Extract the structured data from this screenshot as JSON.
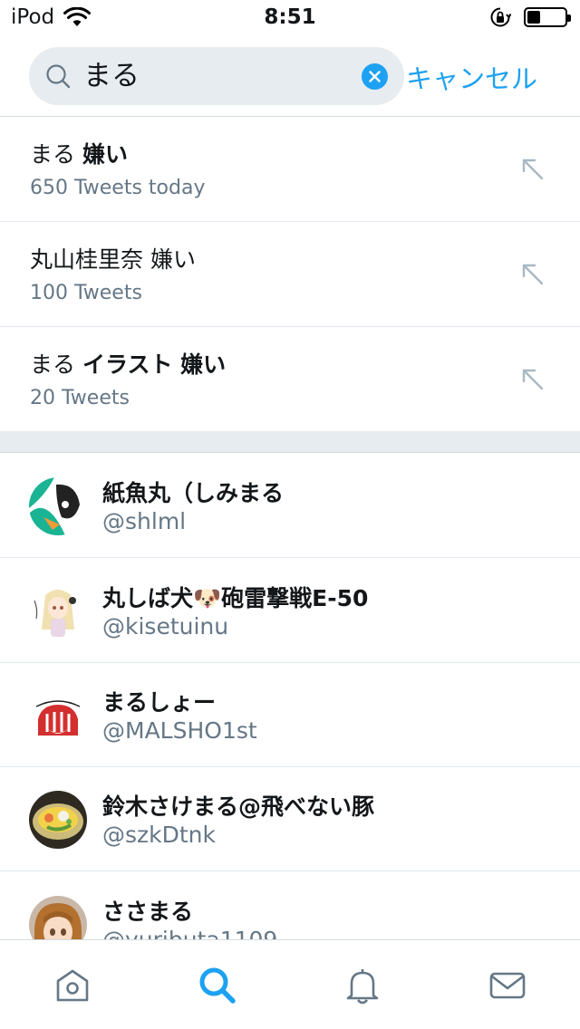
{
  "status_bar": {
    "carrier": "iPod",
    "time": "8:51"
  },
  "search": {
    "query": "まる",
    "cancel_label": "キャンセル"
  },
  "suggestions": [
    {
      "prefix": "まる",
      "bold": "嫌い",
      "count": "650 Tweets today"
    },
    {
      "prefix": "丸山桂里奈 嫌い",
      "bold": "",
      "count": "100 Tweets"
    },
    {
      "prefix": "まる",
      "bold": "イラスト 嫌い",
      "count": "20 Tweets"
    }
  ],
  "users": [
    {
      "name": "紙魚丸（しみまる",
      "handle": "@shlml"
    },
    {
      "name": "丸しば犬🐶砲雷撃戦E-50",
      "handle": "@kisetuinu"
    },
    {
      "name": "まるしょー",
      "handle": "@MALSHO1st"
    },
    {
      "name": "鈴木さけまる@飛べない豚",
      "handle": "@szkDtnk"
    },
    {
      "name": "ささまる",
      "handle": "@yuributa1109"
    }
  ],
  "colors": {
    "accent": "#1da1f2",
    "secondary_text": "#657786",
    "search_bg": "#e6ecf0"
  },
  "tabs": [
    {
      "icon": "home-icon",
      "active": false
    },
    {
      "icon": "search-icon",
      "active": true
    },
    {
      "icon": "bell-icon",
      "active": false
    },
    {
      "icon": "mail-icon",
      "active": false
    }
  ]
}
